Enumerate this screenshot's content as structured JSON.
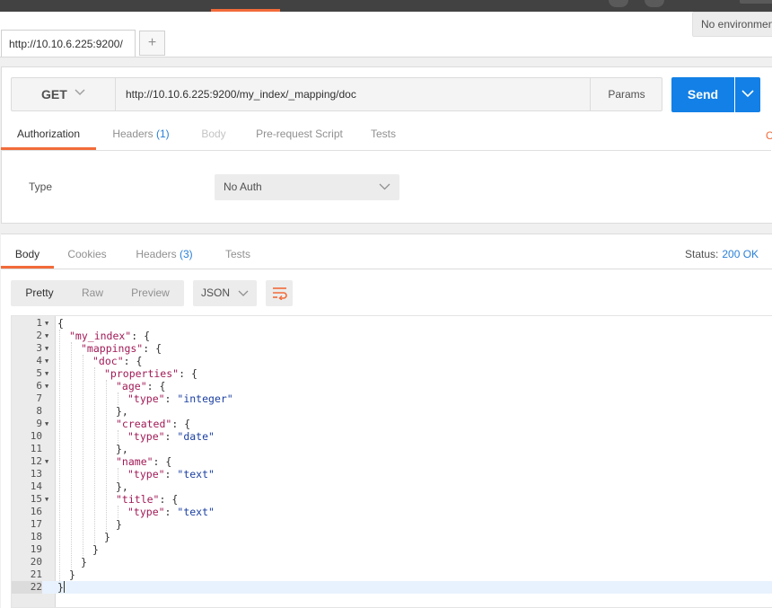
{
  "request_tab": {
    "label": "http://10.10.6.225:9200/",
    "new_tab": "+"
  },
  "environment": {
    "selected": "No environment"
  },
  "request": {
    "method": "GET",
    "url": "http://10.10.6.225:9200/my_index/_mapping/doc",
    "params_label": "Params",
    "send_label": "Send"
  },
  "request_tabs": [
    {
      "label": "Authorization",
      "count": ""
    },
    {
      "label": "Headers",
      "count": "(1)"
    },
    {
      "label": "Body",
      "count": ""
    },
    {
      "label": "Pre-request Script",
      "count": ""
    },
    {
      "label": "Tests",
      "count": ""
    }
  ],
  "right_edge_glyph": "C",
  "auth": {
    "type_label": "Type",
    "type_value": "No Auth"
  },
  "response_tabs": [
    {
      "label": "Body",
      "count": ""
    },
    {
      "label": "Cookies",
      "count": ""
    },
    {
      "label": "Headers",
      "count": "(3)"
    },
    {
      "label": "Tests",
      "count": ""
    }
  ],
  "status": {
    "label": "Status:",
    "value": "200 OK"
  },
  "view_modes": [
    "Pretty",
    "Raw",
    "Preview"
  ],
  "format": {
    "selected": "JSON"
  },
  "code_lines": [
    {
      "n": "1",
      "fold": true,
      "indent": 0,
      "segs": [
        [
          "p",
          "{"
        ]
      ]
    },
    {
      "n": "2",
      "fold": true,
      "indent": 1,
      "segs": [
        [
          "k",
          "\"my_index\""
        ],
        [
          "p",
          ": {"
        ]
      ]
    },
    {
      "n": "3",
      "fold": true,
      "indent": 2,
      "segs": [
        [
          "k",
          "\"mappings\""
        ],
        [
          "p",
          ": {"
        ]
      ]
    },
    {
      "n": "4",
      "fold": true,
      "indent": 3,
      "segs": [
        [
          "k",
          "\"doc\""
        ],
        [
          "p",
          ": {"
        ]
      ]
    },
    {
      "n": "5",
      "fold": true,
      "indent": 4,
      "segs": [
        [
          "k",
          "\"properties\""
        ],
        [
          "p",
          ": {"
        ]
      ]
    },
    {
      "n": "6",
      "fold": true,
      "indent": 5,
      "segs": [
        [
          "k",
          "\"age\""
        ],
        [
          "p",
          ": {"
        ]
      ]
    },
    {
      "n": "7",
      "fold": false,
      "indent": 6,
      "segs": [
        [
          "k",
          "\"type\""
        ],
        [
          "p",
          ": "
        ],
        [
          "s",
          "\"integer\""
        ]
      ]
    },
    {
      "n": "8",
      "fold": false,
      "indent": 5,
      "segs": [
        [
          "p",
          "},"
        ]
      ]
    },
    {
      "n": "9",
      "fold": true,
      "indent": 5,
      "segs": [
        [
          "k",
          "\"created\""
        ],
        [
          "p",
          ": {"
        ]
      ]
    },
    {
      "n": "10",
      "fold": false,
      "indent": 6,
      "segs": [
        [
          "k",
          "\"type\""
        ],
        [
          "p",
          ": "
        ],
        [
          "s",
          "\"date\""
        ]
      ]
    },
    {
      "n": "11",
      "fold": false,
      "indent": 5,
      "segs": [
        [
          "p",
          "},"
        ]
      ]
    },
    {
      "n": "12",
      "fold": true,
      "indent": 5,
      "segs": [
        [
          "k",
          "\"name\""
        ],
        [
          "p",
          ": {"
        ]
      ]
    },
    {
      "n": "13",
      "fold": false,
      "indent": 6,
      "segs": [
        [
          "k",
          "\"type\""
        ],
        [
          "p",
          ": "
        ],
        [
          "s",
          "\"text\""
        ]
      ]
    },
    {
      "n": "14",
      "fold": false,
      "indent": 5,
      "segs": [
        [
          "p",
          "},"
        ]
      ]
    },
    {
      "n": "15",
      "fold": true,
      "indent": 5,
      "segs": [
        [
          "k",
          "\"title\""
        ],
        [
          "p",
          ": {"
        ]
      ]
    },
    {
      "n": "16",
      "fold": false,
      "indent": 6,
      "segs": [
        [
          "k",
          "\"type\""
        ],
        [
          "p",
          ": "
        ],
        [
          "s",
          "\"text\""
        ]
      ]
    },
    {
      "n": "17",
      "fold": false,
      "indent": 5,
      "segs": [
        [
          "p",
          "}"
        ]
      ]
    },
    {
      "n": "18",
      "fold": false,
      "indent": 4,
      "segs": [
        [
          "p",
          "}"
        ]
      ]
    },
    {
      "n": "19",
      "fold": false,
      "indent": 3,
      "segs": [
        [
          "p",
          "}"
        ]
      ]
    },
    {
      "n": "20",
      "fold": false,
      "indent": 2,
      "segs": [
        [
          "p",
          "}"
        ]
      ]
    },
    {
      "n": "21",
      "fold": false,
      "indent": 1,
      "segs": [
        [
          "p",
          "}"
        ]
      ]
    },
    {
      "n": "22",
      "fold": false,
      "indent": 0,
      "segs": [
        [
          "p",
          "}"
        ]
      ],
      "current": true
    }
  ],
  "colors": {
    "accent": "#f26b3a",
    "send": "#1280e6",
    "count": "#2a80d8",
    "json_key": "#a11a56",
    "json_string": "#1a3fa1"
  },
  "icons": {
    "method_dropdown": "chevron-down-icon",
    "send_dropdown": "chevron-down-icon",
    "new_tab": "plus-icon",
    "wrap": "wrap-lines-icon",
    "fold": "fold-arrow-icon"
  }
}
